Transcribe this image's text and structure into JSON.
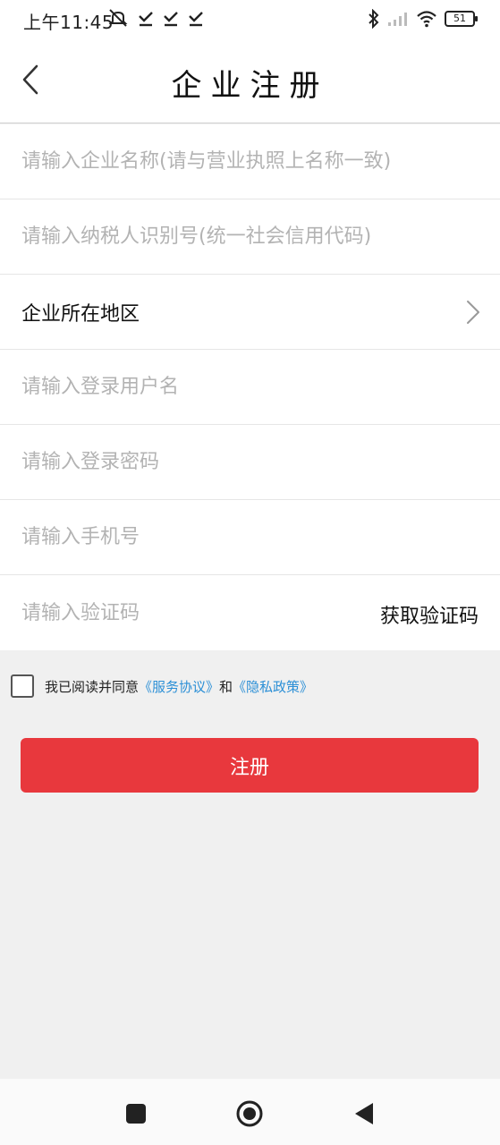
{
  "status_bar": {
    "time": "上午11:45",
    "battery": "51"
  },
  "header": {
    "title": "企业注册"
  },
  "form": {
    "company_name_placeholder": "请输入企业名称(请与营业执照上名称一致)",
    "tax_id_placeholder": "请输入纳税人识别号(统一社会信用代码)",
    "region_label": "企业所在地区",
    "username_placeholder": "请输入登录用户名",
    "password_placeholder": "请输入登录密码",
    "phone_placeholder": "请输入手机号",
    "code_placeholder": "请输入验证码",
    "get_code_label": "获取验证码"
  },
  "agreement": {
    "prefix": "我已阅读并同意",
    "service_link": "《服务协议》",
    "conj": "和",
    "privacy_link": "《隐私政策》"
  },
  "register": {
    "label": "注册"
  },
  "colors": {
    "accent": "#e8383d",
    "link": "#2b8fd6"
  }
}
